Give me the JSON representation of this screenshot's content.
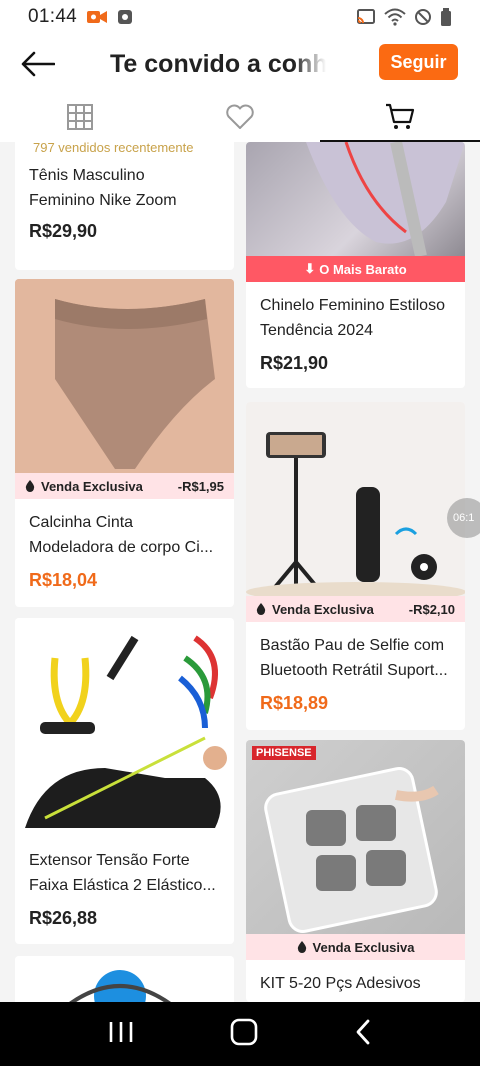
{
  "status_bar": {
    "time": "01:44"
  },
  "header": {
    "title": "Te convido a conh",
    "follow_label": "Seguir"
  },
  "tabs": [
    {
      "icon": "grid-icon",
      "active": false
    },
    {
      "icon": "heart-icon",
      "active": false
    },
    {
      "icon": "cart-icon",
      "active": true
    }
  ],
  "products": [
    {
      "sold": "797 vendidos recentemente",
      "name1": "Tênis Masculino",
      "name2": "Feminino Nike Zoom",
      "price": "R$29,90"
    },
    {
      "promo": "O Mais Barato",
      "name1": "Chinelo Feminino Estiloso",
      "name2": "Tendência 2024",
      "price": "R$21,90"
    },
    {
      "promo": "Venda Exclusiva",
      "discount": "-R$1,95",
      "name1": "Calcinha Cinta",
      "name2": "Modeladora de corpo Ci...",
      "price": "R$18,04"
    },
    {
      "promo": "Venda Exclusiva",
      "discount": "-R$2,10",
      "name1": "Bastão Pau de Selfie com",
      "name2": "Bluetooth Retrátil Suport...",
      "price": "R$18,89"
    },
    {
      "name1": "Extensor Tensão Forte",
      "name2": "Faixa Elástica 2 Elástico...",
      "price": "R$26,88"
    },
    {
      "brand": "PHISENSE",
      "promo": "Venda Exclusiva",
      "name1": "KIT 5-20 Pçs Adesivos",
      "name2": ""
    }
  ],
  "floating_handle": "06:1",
  "colors": {
    "accent": "#fb6a12",
    "price_orange": "#f06a1a",
    "promo_bg": "#ffe3e6",
    "promo_red": "#ff5864"
  }
}
